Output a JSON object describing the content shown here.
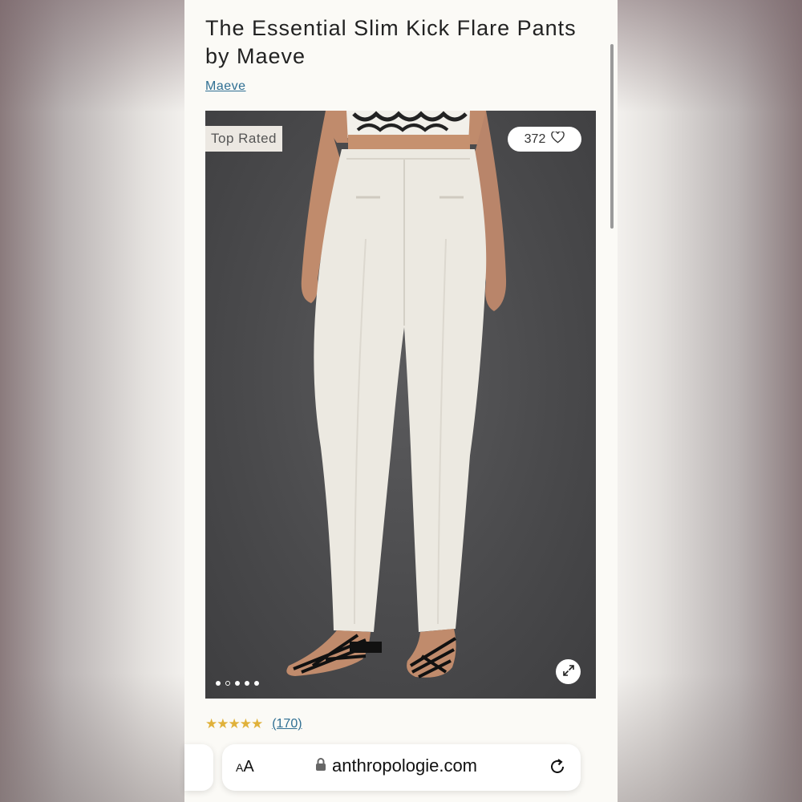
{
  "product": {
    "title": "The Essential Slim Kick Flare Pants by Maeve",
    "brand_link": "Maeve",
    "badge": "Top Rated",
    "favorites_count": "372",
    "favorite_icon": "heart-icon",
    "expand_icon": "expand-icon",
    "image_dots": {
      "total": 5,
      "active_index": 1
    }
  },
  "rating": {
    "stars": "★★★★★",
    "value": 4.5,
    "out_of": 5,
    "reviews_label": "(170)"
  },
  "browser": {
    "text_size_small": "A",
    "text_size_big": "A",
    "lock_icon": "lock-icon",
    "url": "anthropologie.com",
    "reload_icon": "reload-icon"
  },
  "colors": {
    "link": "#2f6f93",
    "star": "#e0b13a",
    "page_bg": "#fbfaf6",
    "photo_bg": "#4a4a4c"
  }
}
